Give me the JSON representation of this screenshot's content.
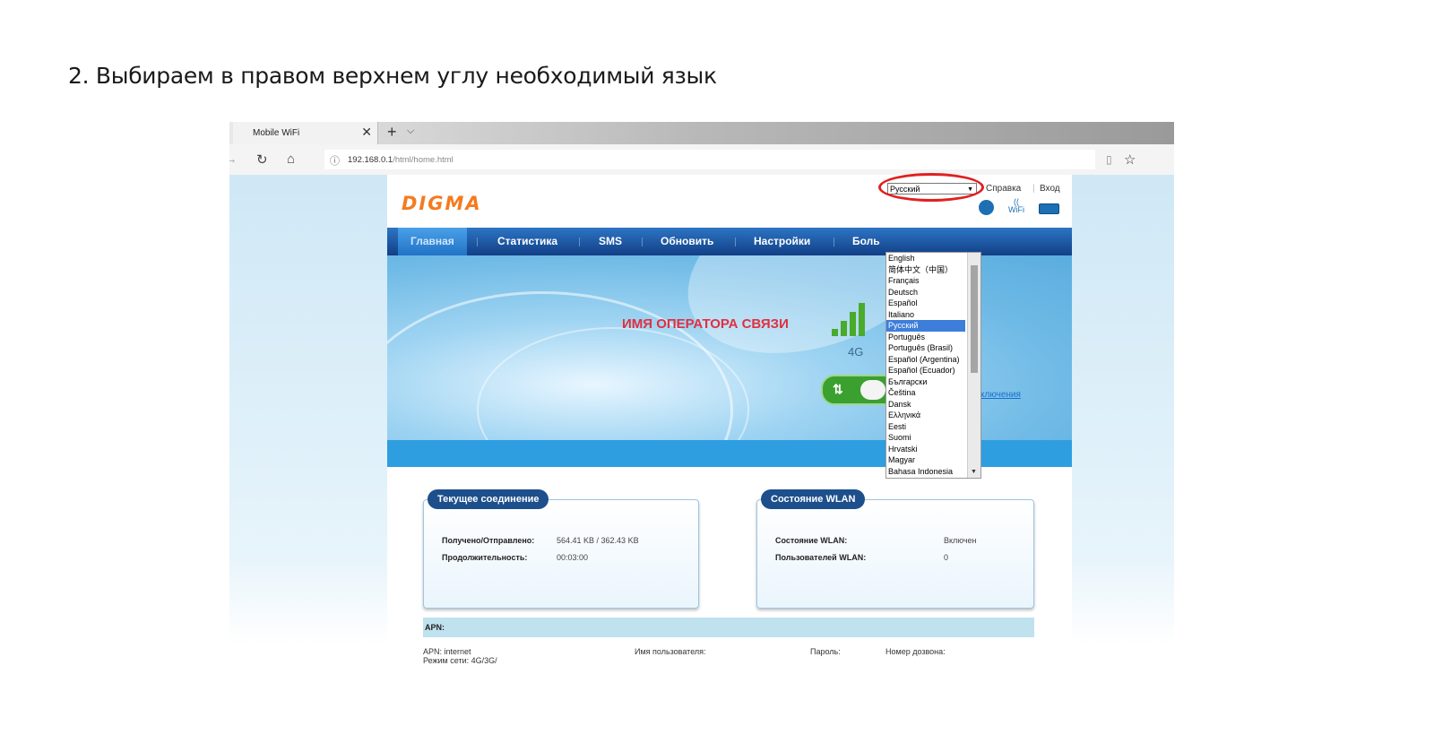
{
  "caption": "2. Выбираем в правом верхнем углу необходимый язык",
  "browser": {
    "tab_title": "Mobile WiFi",
    "tab_close": "✕",
    "new_tab": "+",
    "tab_menu": "⌵",
    "url_host": "192.168.0.1",
    "url_path": "/html/home.html",
    "info_icon": "ⓘ",
    "nav_icons": {
      "back": "→",
      "refresh": "↻",
      "home": "⌂"
    },
    "reader_icon": "▯",
    "star_icon": "☆"
  },
  "page": {
    "logo": "DIGMA",
    "language_selected": "Русский",
    "help_link": "Справка",
    "login_link": "Вход",
    "nav": [
      "Главная",
      "Статистика",
      "SMS",
      "Обновить",
      "Настройки",
      "Боль"
    ],
    "operator_name": "ИМЯ ОПЕРАТОРА СВЯЗИ",
    "network_type": "4G",
    "signal_level": 4,
    "data_toggle_icon": "⇅",
    "connection_link": "ключения",
    "wifi_label": "WiFi",
    "current_connection": {
      "title": "Текущее соединение",
      "rows": [
        {
          "label": "Получено/Отправлено:",
          "value": "564.41 KB /  362.43 KB"
        },
        {
          "label": "Продолжительность:",
          "value": "00:03:00"
        }
      ]
    },
    "wlan_status": {
      "title": "Состояние WLAN",
      "rows": [
        {
          "label": "Состояние WLAN:",
          "value": "Включен"
        },
        {
          "label": "Пользователей WLAN:",
          "value": "0"
        }
      ]
    },
    "apn": {
      "title": "APN:",
      "apn_value": "APN: internet",
      "mode_value": "Режим сети: 4G/3G/",
      "user_label": "Имя пользователя:",
      "password_label": "Пароль:",
      "dial_label": "Номер дозвона:"
    }
  },
  "languages": [
    "English",
    "简体中文（中国）",
    "Français",
    "Deutsch",
    "Español",
    "Italiano",
    "Русский",
    "Português",
    "Português (Brasil)",
    "Español (Argentina)",
    "Español (Ecuador)",
    "Български",
    "Čeština",
    "Dansk",
    "Ελληνικά",
    "Eesti",
    "Suomi",
    "Hrvatski",
    "Magyar",
    "Bahasa Indonesia"
  ],
  "colors": {
    "accent_nav": "#1c4f8c",
    "logo": "#f47b20",
    "operator": "#e03040",
    "signal": "#4aaa2a",
    "highlight_oval": "#e02020",
    "selected_option": "#3d7edb"
  }
}
